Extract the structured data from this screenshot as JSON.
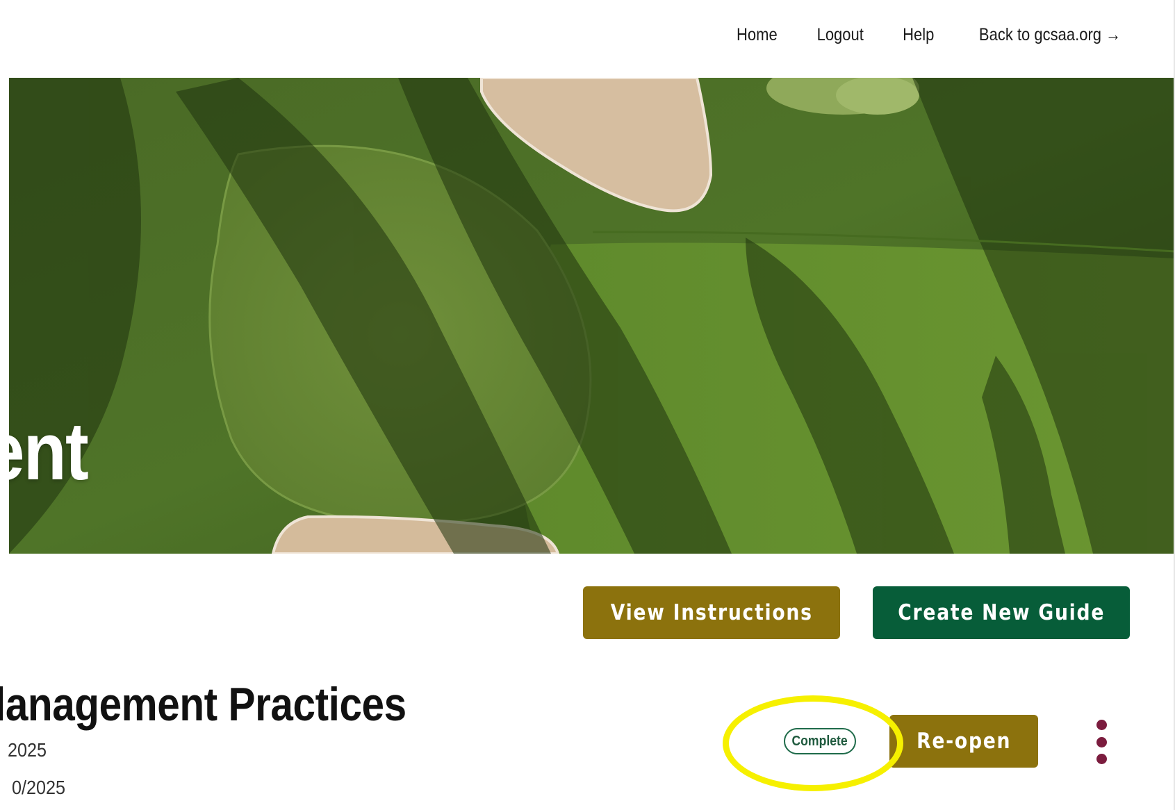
{
  "nav": {
    "home": "Home",
    "logout": "Logout",
    "help": "Help",
    "back": "Back to gcsaa.org →"
  },
  "hero": {
    "title": "ent",
    "image": "golf-green-aerial-photo"
  },
  "actions": {
    "view_instructions": "View Instructions",
    "create_new_guide": "Create New Guide"
  },
  "guide": {
    "title": "lanagement Practices",
    "date_1": "2025",
    "date_2": "0/2025",
    "status": "Complete",
    "reopen_label": "Re-open",
    "menu_icon": "more-vertical-icon"
  },
  "colors": {
    "gold": "#8c720d",
    "green": "#075d39",
    "maroon": "#7b1c3e",
    "highlight": "#f6f000"
  }
}
